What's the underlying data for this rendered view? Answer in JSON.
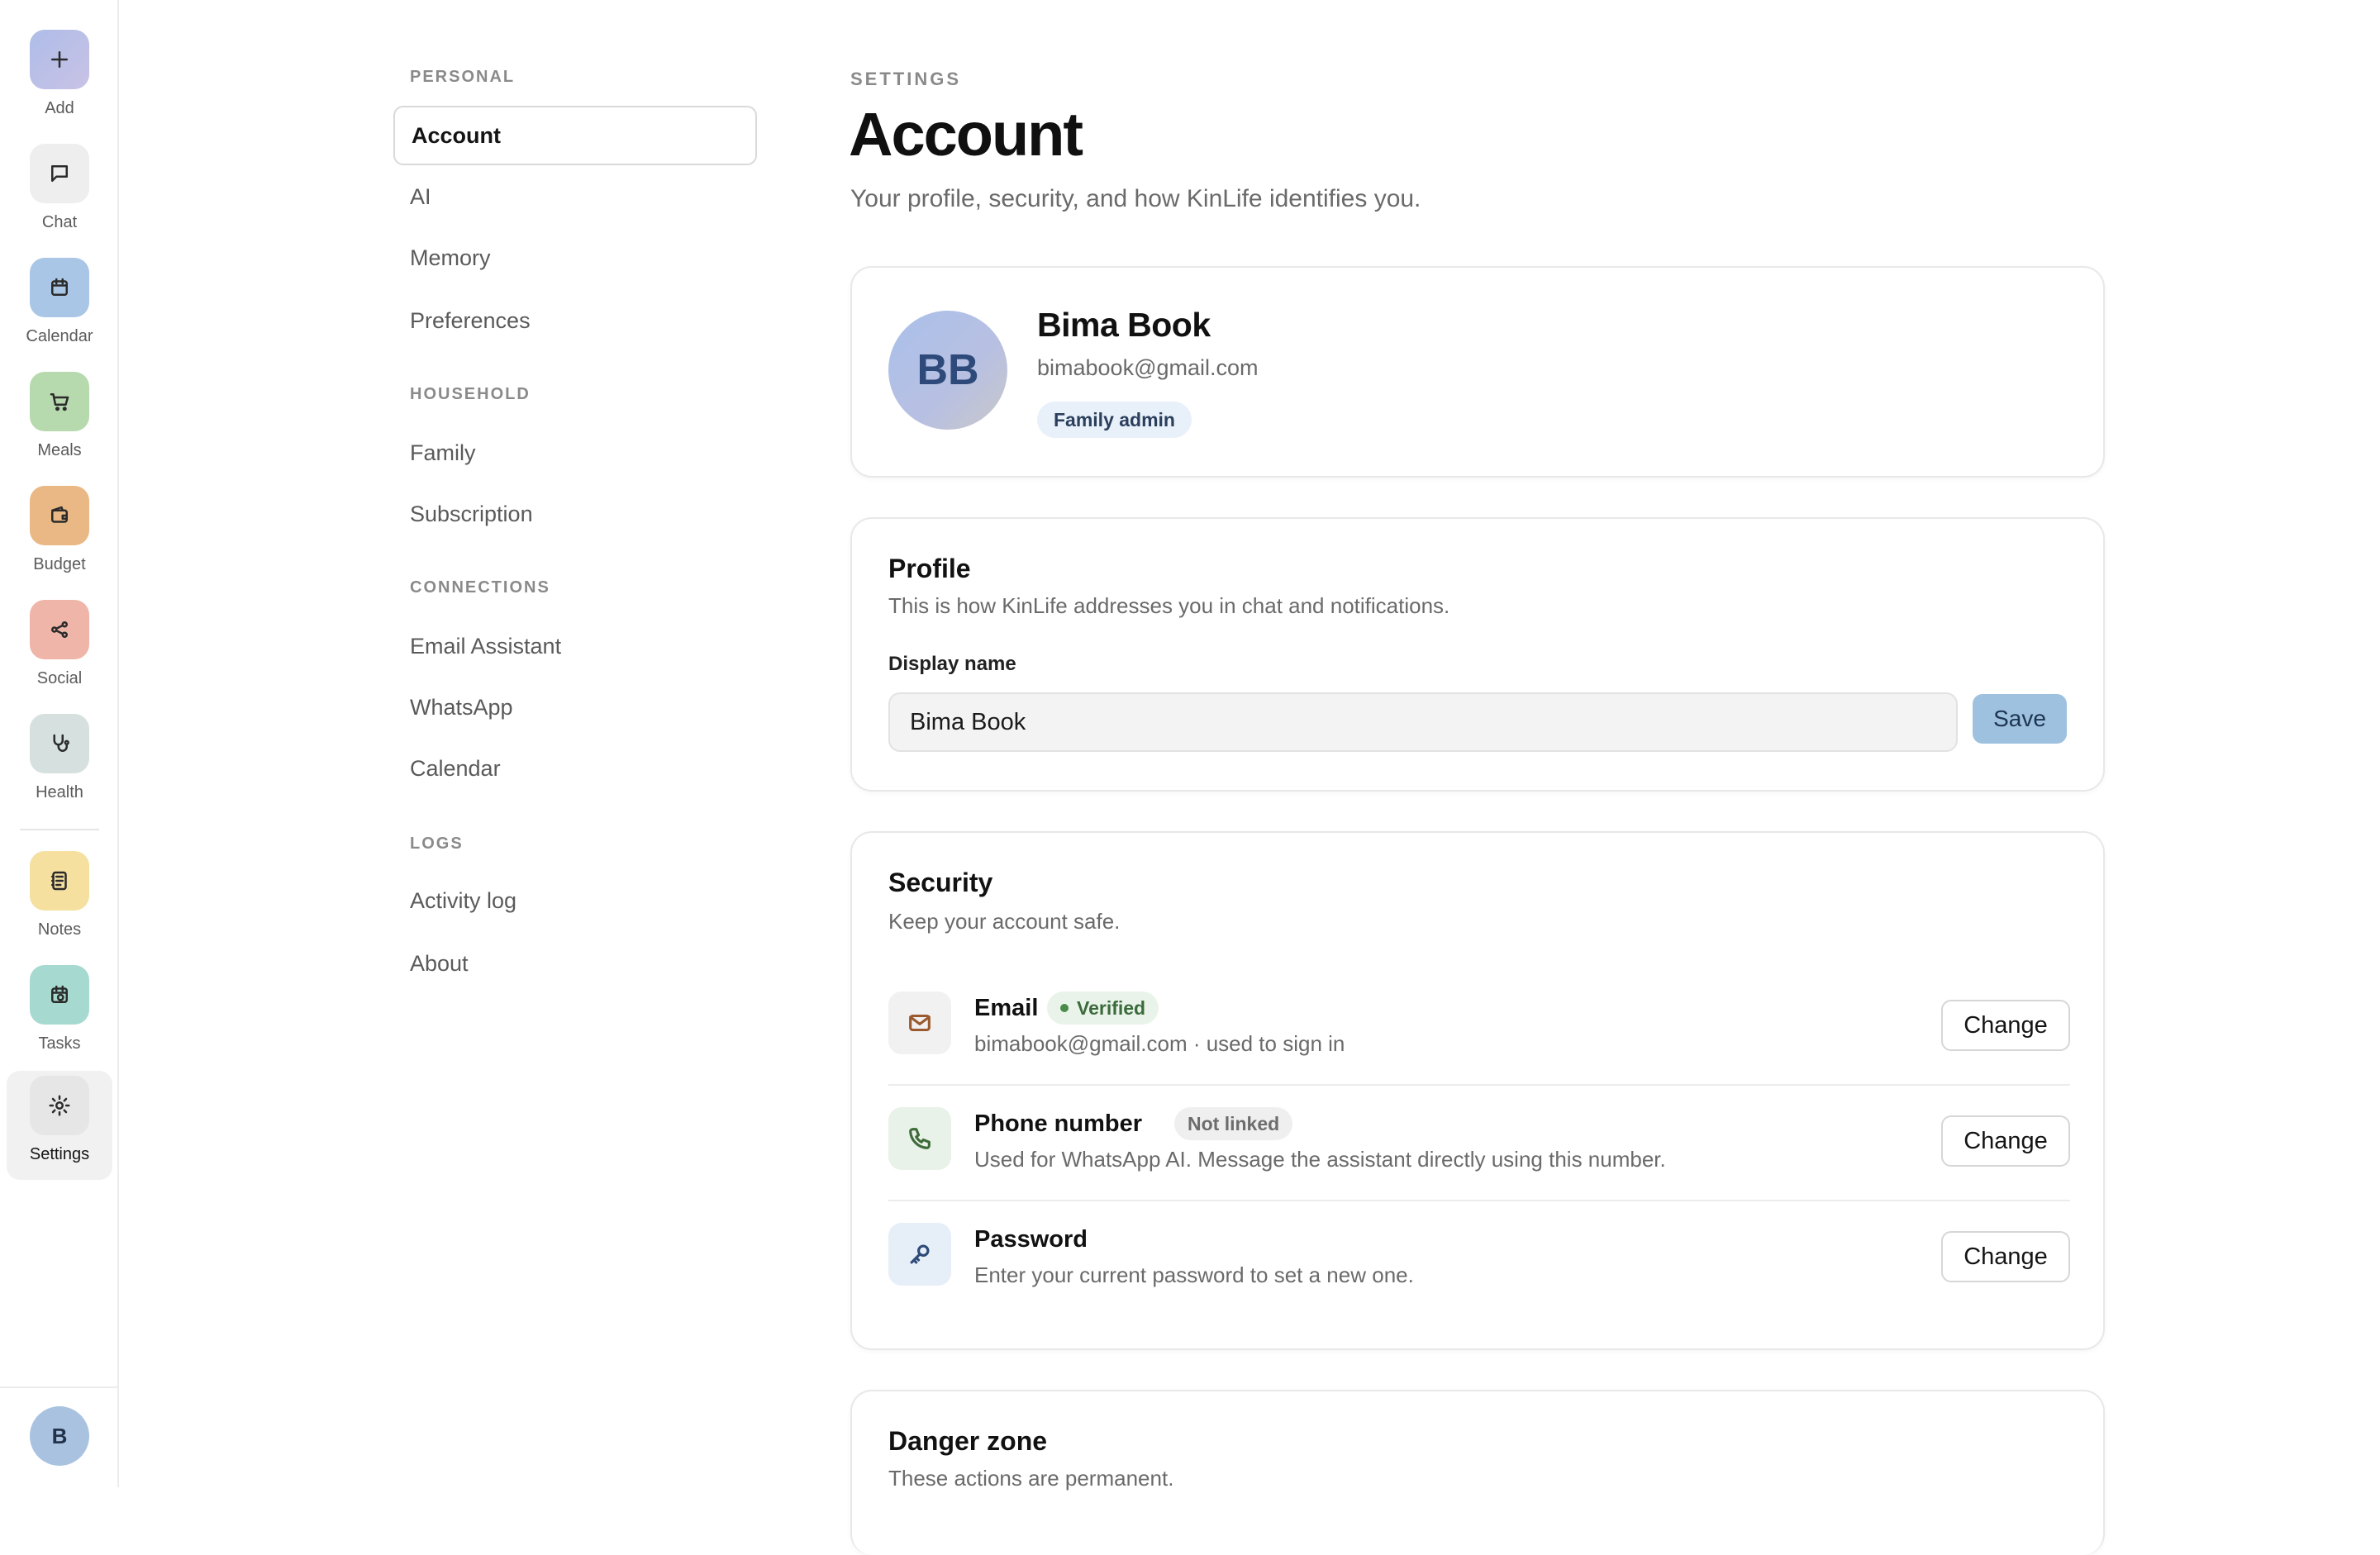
{
  "rail": {
    "items": [
      {
        "label": "Add",
        "icon": "plus-icon",
        "color": "#b3bfe6"
      },
      {
        "label": "Chat",
        "icon": "chat-bubble-icon",
        "color": "#eeeeee"
      },
      {
        "label": "Calendar",
        "icon": "calendar-icon",
        "color": "#a9c6e6"
      },
      {
        "label": "Meals",
        "icon": "cart-icon",
        "color": "#b7d9ae"
      },
      {
        "label": "Budget",
        "icon": "wallet-icon",
        "color": "#e9b884"
      },
      {
        "label": "Social",
        "icon": "share-icon",
        "color": "#efb5a8"
      },
      {
        "label": "Health",
        "icon": "stethoscope-icon",
        "color": "#d6e1df"
      },
      {
        "label": "Notes",
        "icon": "notebook-icon",
        "color": "#f5e0a0"
      },
      {
        "label": "Tasks",
        "icon": "task-calendar-icon",
        "color": "#a6d9d0"
      },
      {
        "label": "Settings",
        "icon": "gear-icon",
        "color": "#e6e6e6"
      }
    ],
    "avatar_initial": "B"
  },
  "settings_nav": {
    "sections": [
      {
        "heading": "PERSONAL",
        "items": [
          "Account",
          "AI",
          "Memory",
          "Preferences"
        ]
      },
      {
        "heading": "HOUSEHOLD",
        "items": [
          "Family",
          "Subscription"
        ]
      },
      {
        "heading": "CONNECTIONS",
        "items": [
          "Email Assistant",
          "WhatsApp",
          "Calendar"
        ]
      },
      {
        "heading": "LOGS",
        "items": [
          "Activity log",
          "About"
        ]
      }
    ],
    "active": "Account"
  },
  "header": {
    "eyebrow": "SETTINGS",
    "title": "Account",
    "subtitle": "Your profile, security, and how KinLife identifies you."
  },
  "user": {
    "initials": "BB",
    "name": "Bima Book",
    "email": "bimabook@gmail.com",
    "role": "Family admin"
  },
  "profile": {
    "title": "Profile",
    "subtitle": "This is how KinLife addresses you in chat and notifications.",
    "display_name_label": "Display name",
    "display_name_value": "Bima Book",
    "save_label": "Save"
  },
  "security": {
    "title": "Security",
    "subtitle": "Keep your account safe.",
    "rows": [
      {
        "title": "Email",
        "badge": "Verified",
        "description": "bimabook@gmail.com · used to sign in",
        "action": "Change",
        "icon_color": "#f1f1f1"
      },
      {
        "title": "Phone number",
        "badge": "Not linked",
        "description": "Used for WhatsApp AI. Message the assistant directly using this number.",
        "action": "Change",
        "icon_color": "#e9f2e8"
      },
      {
        "title": "Password",
        "badge": "",
        "description": "Enter your current password to set a new one.",
        "action": "Change",
        "icon_color": "#e6eef8"
      }
    ]
  },
  "danger": {
    "title": "Danger zone",
    "subtitle": "These actions are permanent."
  }
}
